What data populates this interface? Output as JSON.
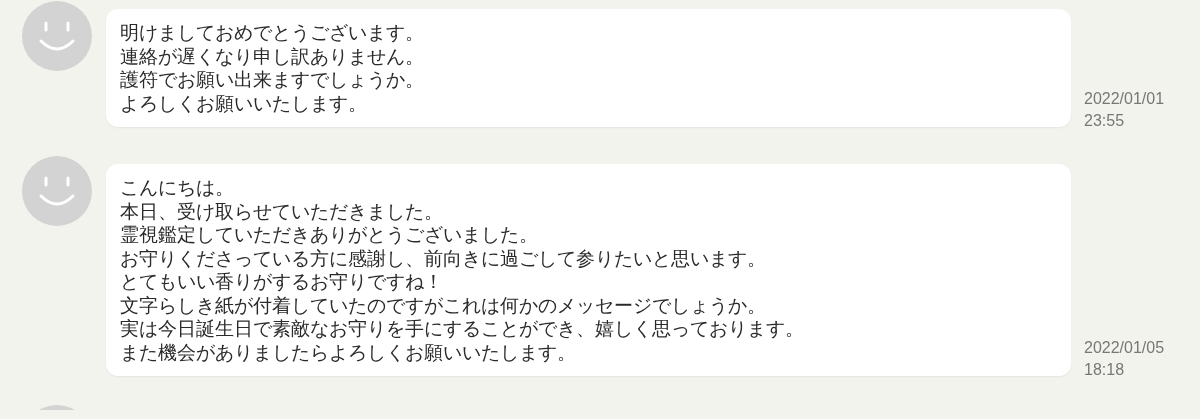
{
  "messages": [
    {
      "lines": [
        "明けましておめでとうございます。",
        "連絡が遅くなり申し訳ありません。",
        "護符でお願い出来ますでしょうか。",
        "よろしくお願いいたします。"
      ],
      "date": "2022/01/01",
      "time": "23:55"
    },
    {
      "lines": [
        "こんにちは。",
        "本日、受け取らせていただきました。",
        "霊視鑑定していただきありがとうございました。",
        "お守りくださっている方に感謝し、前向きに過ごして参りたいと思います。",
        "とてもいい香りがするお守りですね！",
        "文字らしき紙が付着していたのですがこれは何かのメッセージでしょうか。",
        "実は今日誕生日で素敵なお守りを手にすることができ、嬉しく思っております。",
        "また機会がありましたらよろしくお願いいたします。"
      ],
      "date": "2022/01/05",
      "time": "18:18"
    }
  ],
  "more_below": true
}
